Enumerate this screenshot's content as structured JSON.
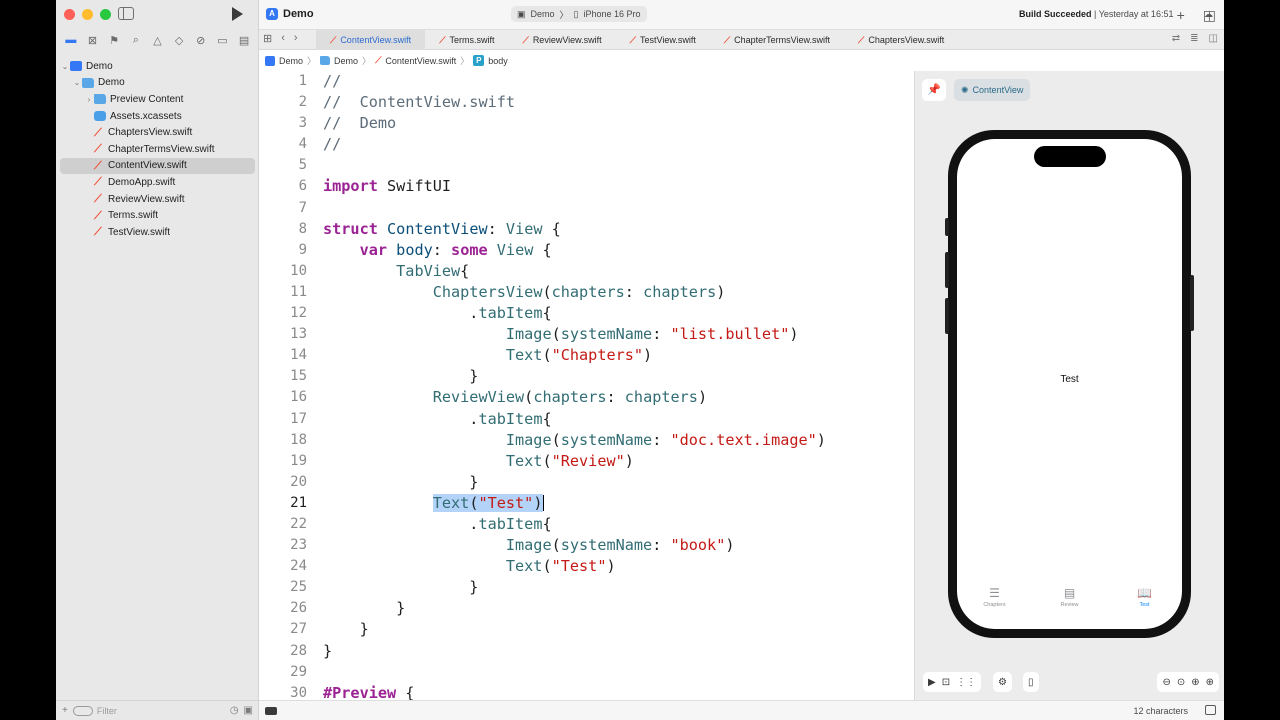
{
  "toolbar": {
    "app_name": "Demo",
    "scheme": "Demo",
    "destination": "iPhone 16 Pro",
    "status_bold": "Build Succeeded",
    "status_time": "Yesterday at 16:51"
  },
  "sidebar": {
    "root": "Demo",
    "items": [
      {
        "label": "Demo",
        "icon": "folder-icon",
        "level": 1
      },
      {
        "label": "Preview Content",
        "icon": "folder-icon",
        "level": 2
      },
      {
        "label": "Assets.xcassets",
        "icon": "assets-icon",
        "level": 2
      },
      {
        "label": "ChaptersView.swift",
        "icon": "swift-file-icon",
        "level": 2
      },
      {
        "label": "ChapterTermsView.swift",
        "icon": "swift-file-icon",
        "level": 2
      },
      {
        "label": "ContentView.swift",
        "icon": "swift-file-icon",
        "level": 2,
        "selected": true
      },
      {
        "label": "DemoApp.swift",
        "icon": "swift-file-icon",
        "level": 2
      },
      {
        "label": "ReviewView.swift",
        "icon": "swift-file-icon",
        "level": 2
      },
      {
        "label": "Terms.swift",
        "icon": "swift-file-icon",
        "level": 2
      },
      {
        "label": "TestView.swift",
        "icon": "swift-file-icon",
        "level": 2
      }
    ],
    "filter_placeholder": "Filter"
  },
  "tabs": [
    {
      "label": "ContentView.swift",
      "active": true
    },
    {
      "label": "Terms.swift"
    },
    {
      "label": "ReviewView.swift"
    },
    {
      "label": "TestView.swift"
    },
    {
      "label": "ChapterTermsView.swift"
    },
    {
      "label": "ChaptersView.swift"
    }
  ],
  "breadcrumb": {
    "project": "Demo",
    "group": "Demo",
    "file": "ContentView.swift",
    "symbol_badge": "P",
    "symbol": "body"
  },
  "editor": {
    "current_line": 21,
    "lines": [
      [
        [
          "cm",
          "//"
        ]
      ],
      [
        [
          "cm",
          "//  ContentView.swift"
        ]
      ],
      [
        [
          "cm",
          "//  Demo"
        ]
      ],
      [
        [
          "cm",
          "//"
        ]
      ],
      [],
      [
        [
          "kw",
          "import"
        ],
        [
          "p",
          " SwiftUI"
        ]
      ],
      [],
      [
        [
          "kw",
          "struct"
        ],
        [
          "p",
          " "
        ],
        [
          "ty",
          "ContentView"
        ],
        [
          "p",
          ": "
        ],
        [
          "ty2",
          "View"
        ],
        [
          "p",
          " {"
        ]
      ],
      [
        [
          "p",
          "    "
        ],
        [
          "kw",
          "var"
        ],
        [
          "p",
          " "
        ],
        [
          "ty",
          "body"
        ],
        [
          "p",
          ": "
        ],
        [
          "kw",
          "some"
        ],
        [
          "p",
          " "
        ],
        [
          "ty2",
          "View"
        ],
        [
          "p",
          " {"
        ]
      ],
      [
        [
          "p",
          "        "
        ],
        [
          "ty2",
          "TabView"
        ],
        [
          "p",
          "{"
        ]
      ],
      [
        [
          "p",
          "            "
        ],
        [
          "ty2",
          "ChaptersView"
        ],
        [
          "p",
          "("
        ],
        [
          "fn",
          "chapters"
        ],
        [
          "p",
          ": "
        ],
        [
          "fn",
          "chapters"
        ],
        [
          "p",
          ")"
        ]
      ],
      [
        [
          "p",
          "                ."
        ],
        [
          "fn",
          "tabItem"
        ],
        [
          "p",
          "{"
        ]
      ],
      [
        [
          "p",
          "                    "
        ],
        [
          "ty2",
          "Image"
        ],
        [
          "p",
          "("
        ],
        [
          "fn",
          "systemName"
        ],
        [
          "p",
          ": "
        ],
        [
          "str",
          "\"list.bullet\""
        ],
        [
          "p",
          ")"
        ]
      ],
      [
        [
          "p",
          "                    "
        ],
        [
          "ty2",
          "Text"
        ],
        [
          "p",
          "("
        ],
        [
          "str",
          "\"Chapters\""
        ],
        [
          "p",
          ")"
        ]
      ],
      [
        [
          "p",
          "                }"
        ]
      ],
      [
        [
          "p",
          "            "
        ],
        [
          "ty2",
          "ReviewView"
        ],
        [
          "p",
          "("
        ],
        [
          "fn",
          "chapters"
        ],
        [
          "p",
          ": "
        ],
        [
          "fn",
          "chapters"
        ],
        [
          "p",
          ")"
        ]
      ],
      [
        [
          "p",
          "                ."
        ],
        [
          "fn",
          "tabItem"
        ],
        [
          "p",
          "{"
        ]
      ],
      [
        [
          "p",
          "                    "
        ],
        [
          "ty2",
          "Image"
        ],
        [
          "p",
          "("
        ],
        [
          "fn",
          "systemName"
        ],
        [
          "p",
          ": "
        ],
        [
          "str",
          "\"doc.text.image\""
        ],
        [
          "p",
          ")"
        ]
      ],
      [
        [
          "p",
          "                    "
        ],
        [
          "ty2",
          "Text"
        ],
        [
          "p",
          "("
        ],
        [
          "str",
          "\"Review\""
        ],
        [
          "p",
          ")"
        ]
      ],
      [
        [
          "p",
          "                }"
        ]
      ],
      [
        [
          "p",
          "            "
        ],
        [
          "sel:ty2",
          "Text"
        ],
        [
          "sel:p",
          "("
        ],
        [
          "sel:str",
          "\"Test\""
        ],
        [
          "sel:p",
          ")"
        ],
        [
          "caret",
          ""
        ]
      ],
      [
        [
          "p",
          "                ."
        ],
        [
          "fn",
          "tabItem"
        ],
        [
          "p",
          "{"
        ]
      ],
      [
        [
          "p",
          "                    "
        ],
        [
          "ty2",
          "Image"
        ],
        [
          "p",
          "("
        ],
        [
          "fn",
          "systemName"
        ],
        [
          "p",
          ": "
        ],
        [
          "str",
          "\"book\""
        ],
        [
          "p",
          ")"
        ]
      ],
      [
        [
          "p",
          "                    "
        ],
        [
          "ty2",
          "Text"
        ],
        [
          "p",
          "("
        ],
        [
          "str",
          "\"Test\""
        ],
        [
          "p",
          ")"
        ]
      ],
      [
        [
          "p",
          "                }"
        ]
      ],
      [
        [
          "p",
          "        }"
        ]
      ],
      [
        [
          "p",
          "    }"
        ]
      ],
      [
        [
          "p",
          "}"
        ]
      ],
      [],
      [
        [
          "kw",
          "#Preview"
        ],
        [
          "p",
          " {"
        ]
      ]
    ]
  },
  "canvas": {
    "preview_label": "ContentView",
    "screen_text": "Test",
    "phone_tabs": [
      {
        "label": "Chapters",
        "icon": "list-bullet-icon",
        "glyph": "☰",
        "active": false
      },
      {
        "label": "Review",
        "icon": "doc-text-image-icon",
        "glyph": "▤",
        "active": false
      },
      {
        "label": "Test",
        "icon": "book-icon",
        "glyph": "📖",
        "active": true
      }
    ]
  },
  "statusbar": {
    "chars": "12 characters"
  },
  "colors": {
    "accent": "#3478f6",
    "swift": "#f05138",
    "selection": "#b3d3f8",
    "keyword": "#9b2393",
    "string": "#c41a16",
    "type": "#326d74"
  }
}
